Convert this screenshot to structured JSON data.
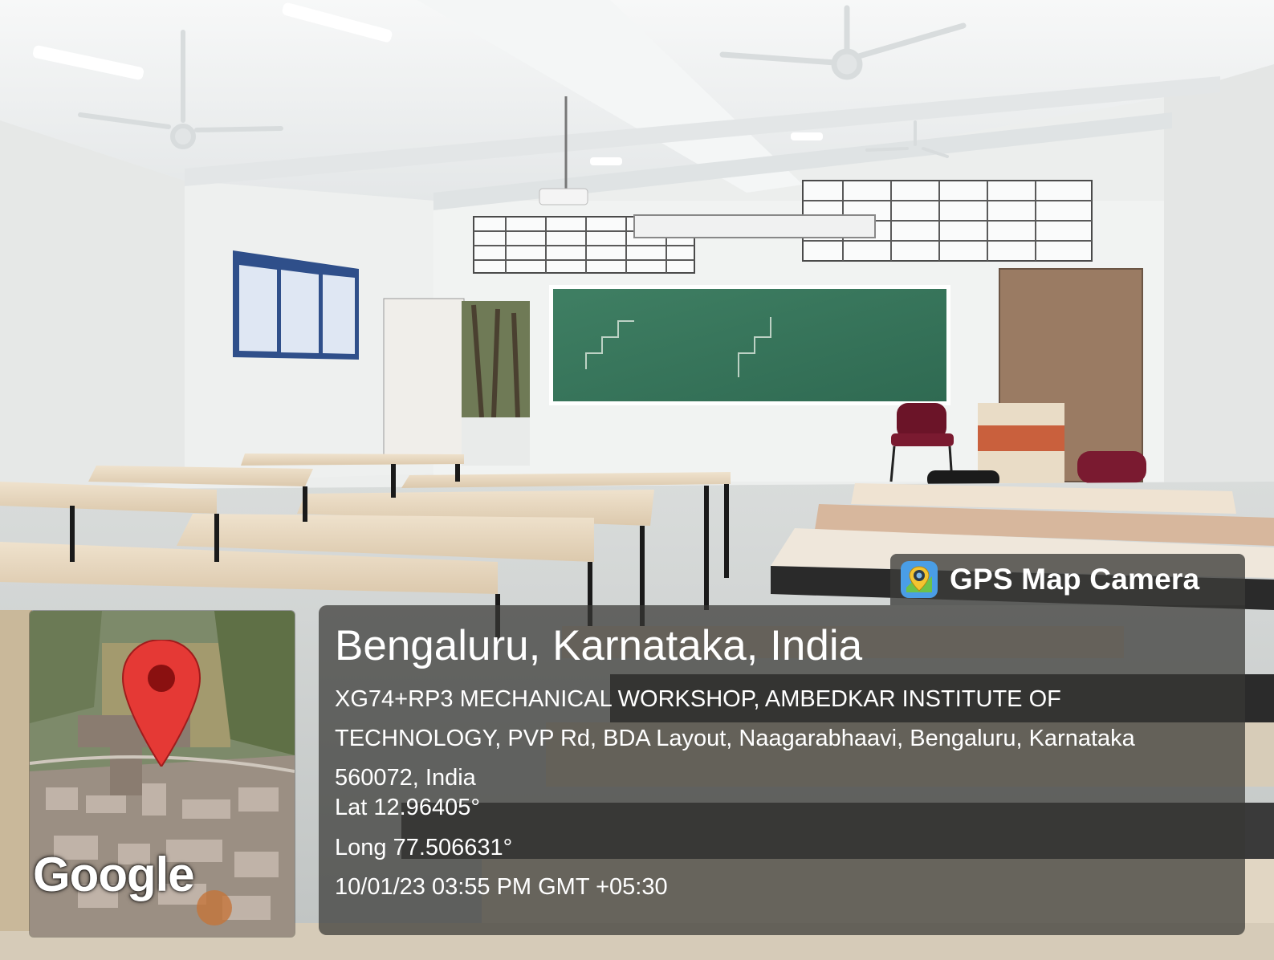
{
  "app_badge": {
    "icon": "map-pin-camera-icon",
    "label": "GPS Map Camera"
  },
  "location": {
    "title": "Bengaluru, Karnataka, India",
    "address_lines": [
      "XG74+RP3 MECHANICAL WORKSHOP, AMBEDKAR INSTITUTE OF",
      "TECHNOLOGY, PVP Rd, BDA Layout, Naagarabhaavi, Bengaluru, Karnataka",
      "560072, India"
    ],
    "latitude": "Lat 12.96405°",
    "longitude": "Long 77.506631°",
    "timestamp": "10/01/23 03:55 PM GMT +05:30"
  },
  "map": {
    "attribution": "Google",
    "marker": "map-pin-icon"
  }
}
